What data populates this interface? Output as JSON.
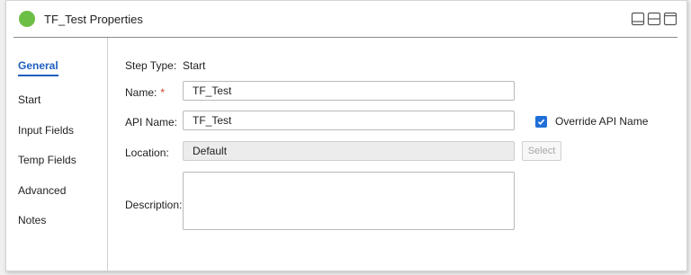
{
  "header": {
    "title": "TF_Test Properties",
    "status_color": "#6dbe45",
    "view_icons": [
      "layout-bottom-panel-icon",
      "layout-split-panel-icon",
      "layout-window-icon"
    ]
  },
  "nav": {
    "items": [
      {
        "label": "General",
        "active": true
      },
      {
        "label": "Start",
        "active": false
      },
      {
        "label": "Input Fields",
        "active": false
      },
      {
        "label": "Temp Fields",
        "active": false
      },
      {
        "label": "Advanced",
        "active": false
      },
      {
        "label": "Notes",
        "active": false
      }
    ]
  },
  "form": {
    "step_type": {
      "label": "Step Type:",
      "value": "Start"
    },
    "name": {
      "label": "Name:",
      "required_mark": "*",
      "value": "TF_Test"
    },
    "api_name": {
      "label": "API Name:",
      "value": "TF_Test"
    },
    "override": {
      "label": "Override API Name",
      "checked": true
    },
    "location": {
      "label": "Location:",
      "value": "Default",
      "select_label": "Select"
    },
    "description": {
      "label": "Description:",
      "value": ""
    }
  }
}
